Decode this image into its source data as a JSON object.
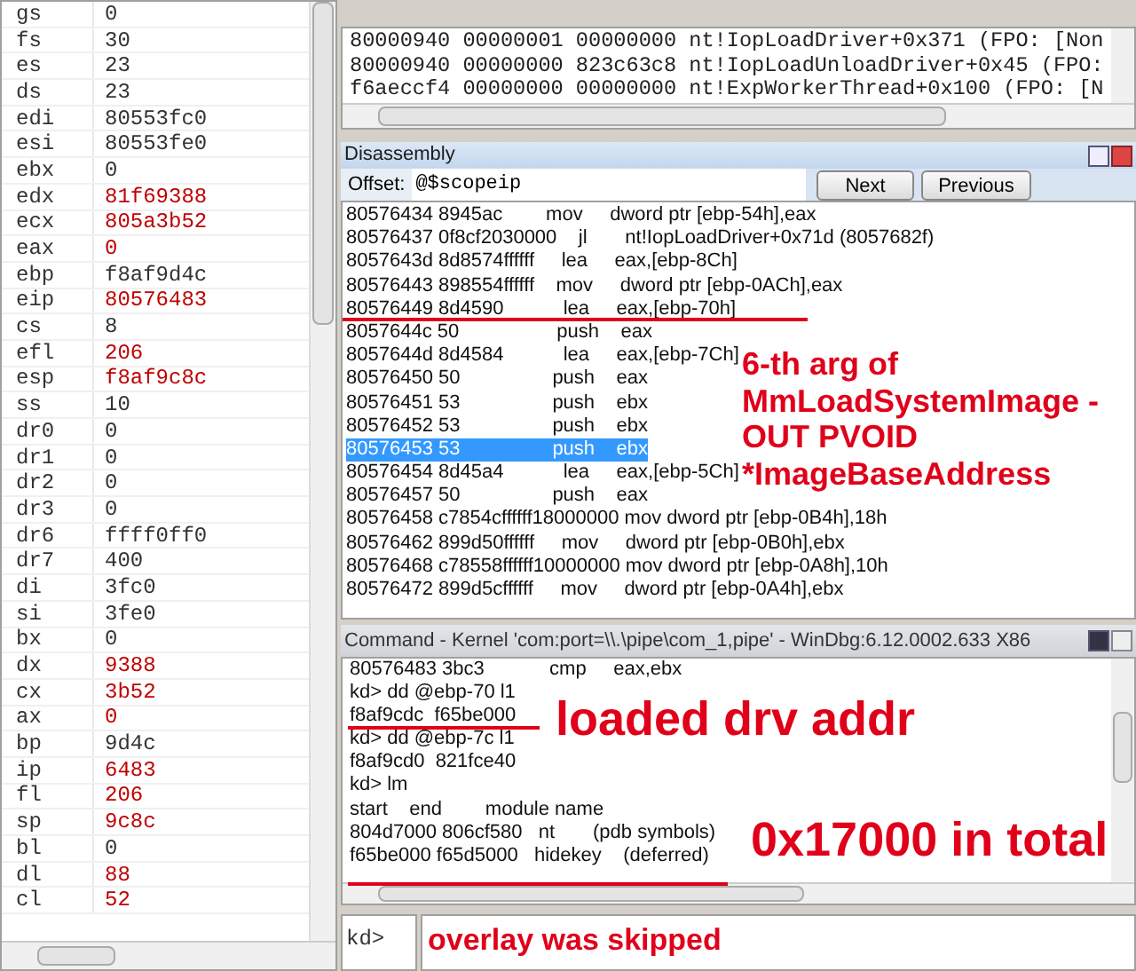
{
  "registers": [
    {
      "name": "gs",
      "value": "0",
      "changed": false
    },
    {
      "name": "fs",
      "value": "30",
      "changed": false
    },
    {
      "name": "es",
      "value": "23",
      "changed": false
    },
    {
      "name": "ds",
      "value": "23",
      "changed": false
    },
    {
      "name": "edi",
      "value": "80553fc0",
      "changed": false
    },
    {
      "name": "esi",
      "value": "80553fe0",
      "changed": false
    },
    {
      "name": "ebx",
      "value": "0",
      "changed": false
    },
    {
      "name": "edx",
      "value": "81f69388",
      "changed": true
    },
    {
      "name": "ecx",
      "value": "805a3b52",
      "changed": true
    },
    {
      "name": "eax",
      "value": "0",
      "changed": true
    },
    {
      "name": "ebp",
      "value": "f8af9d4c",
      "changed": false
    },
    {
      "name": "eip",
      "value": "80576483",
      "changed": true
    },
    {
      "name": "cs",
      "value": "8",
      "changed": false
    },
    {
      "name": "efl",
      "value": "206",
      "changed": true
    },
    {
      "name": "esp",
      "value": "f8af9c8c",
      "changed": true
    },
    {
      "name": "ss",
      "value": "10",
      "changed": false
    },
    {
      "name": "dr0",
      "value": "0",
      "changed": false
    },
    {
      "name": "dr1",
      "value": "0",
      "changed": false
    },
    {
      "name": "dr2",
      "value": "0",
      "changed": false
    },
    {
      "name": "dr3",
      "value": "0",
      "changed": false
    },
    {
      "name": "dr6",
      "value": "ffff0ff0",
      "changed": false
    },
    {
      "name": "dr7",
      "value": "400",
      "changed": false
    },
    {
      "name": "di",
      "value": "3fc0",
      "changed": false
    },
    {
      "name": "si",
      "value": "3fe0",
      "changed": false
    },
    {
      "name": "bx",
      "value": "0",
      "changed": false
    },
    {
      "name": "dx",
      "value": "9388",
      "changed": true
    },
    {
      "name": "cx",
      "value": "3b52",
      "changed": true
    },
    {
      "name": "ax",
      "value": "0",
      "changed": true
    },
    {
      "name": "bp",
      "value": "9d4c",
      "changed": false
    },
    {
      "name": "ip",
      "value": "6483",
      "changed": true
    },
    {
      "name": "fl",
      "value": "206",
      "changed": true
    },
    {
      "name": "sp",
      "value": "9c8c",
      "changed": true
    },
    {
      "name": "bl",
      "value": "0",
      "changed": false
    },
    {
      "name": "dl",
      "value": "88",
      "changed": true
    },
    {
      "name": "cl",
      "value": "52",
      "changed": true
    }
  ],
  "stack": [
    "80000940 00000001 00000000 nt!IopLoadDriver+0x371 (FPO: [Non",
    "80000940 00000000 823c63c8 nt!IopLoadUnloadDriver+0x45 (FPO:",
    "f6aeccf4 00000000 00000000 nt!ExpWorkerThread+0x100 (FPO: [N"
  ],
  "disassembly": {
    "title": "Disassembly",
    "offset_label": "Offset:",
    "offset_value": "@$scopeip",
    "buttons": [
      "Next",
      "Previous"
    ],
    "lines": [
      {
        "text": "80576434 8945ac        mov     dword ptr [ebp-54h],eax",
        "selected": false
      },
      {
        "text": "80576437 0f8cf2030000    jl       nt!IopLoadDriver+0x71d (8057682f)",
        "selected": false
      },
      {
        "text": "8057643d 8d8574ffffff     lea     eax,[ebp-8Ch]",
        "selected": false
      },
      {
        "text": "80576443 898554ffffff    mov     dword ptr [ebp-0ACh],eax",
        "selected": false
      },
      {
        "text": "80576449 8d4590           lea     eax,[ebp-70h]",
        "selected": false
      },
      {
        "text": "8057644c 50                  push    eax",
        "selected": false
      },
      {
        "text": "8057644d 8d4584           lea     eax,[ebp-7Ch]",
        "selected": false
      },
      {
        "text": "80576450 50                 push    eax",
        "selected": false
      },
      {
        "text": "80576451 53                 push    ebx",
        "selected": false
      },
      {
        "text": "80576452 53                 push    ebx",
        "selected": false
      },
      {
        "text": "80576453 53                 push    ebx",
        "selected": true
      },
      {
        "text": "80576454 8d45a4           lea     eax,[ebp-5Ch]",
        "selected": false
      },
      {
        "text": "80576457 50                 push    eax",
        "selected": false
      },
      {
        "text": "80576458 c7854cffffff18000000 mov dword ptr [ebp-0B4h],18h",
        "selected": false
      },
      {
        "text": "80576462 899d50ffffff     mov     dword ptr [ebp-0B0h],ebx",
        "selected": false
      },
      {
        "text": "80576468 c78558ffffff10000000 mov dword ptr [ebp-0A8h],10h",
        "selected": false
      },
      {
        "text": "80576472 899d5cffffff     mov     dword ptr [ebp-0A4h],ebx",
        "selected": false
      }
    ]
  },
  "command": {
    "title": "Command - Kernel 'com:port=\\\\.\\pipe\\com_1,pipe' - WinDbg:6.12.0002.633 X86",
    "lines": [
      "80576483 3bc3            cmp     eax,ebx",
      "kd> dd @ebp-70 l1",
      "f8af9cdc  f65be000",
      "kd> dd @ebp-7c l1",
      "f8af9cd0  821fce40",
      "kd> lm",
      "start    end        module name",
      "804d7000 806cf580   nt       (pdb symbols)",
      "f65be000 f65d5000   hidekey    (deferred)"
    ],
    "prompt": "kd>"
  },
  "annotations": [
    "6-th arg of MmLoadSystemImage - OUT PVOID *ImageBaseAddress",
    "loaded drv addr",
    "0x17000 in total",
    "overlay was skipped"
  ]
}
